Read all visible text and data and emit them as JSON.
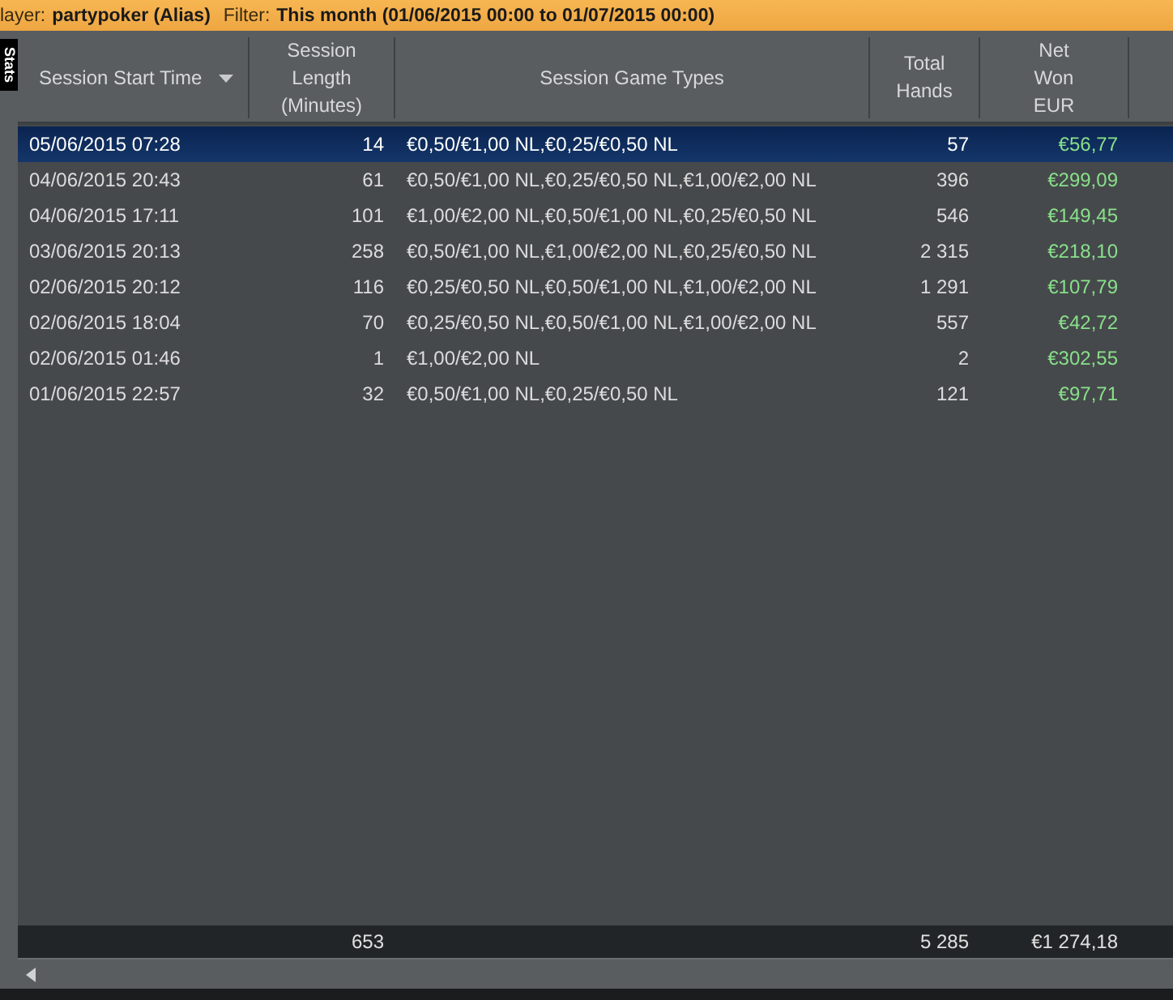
{
  "filter_bar": {
    "player_label": "layer:",
    "player": "partypoker (Alias)",
    "filter_label": "Filter:",
    "filter": "This month (01/06/2015 00:00 to 01/07/2015 00:00)"
  },
  "side_tab": {
    "label": "Stats"
  },
  "table": {
    "columns": [
      {
        "label": "Session Start Time",
        "sorted": true
      },
      {
        "label": "Session Length (Minutes)",
        "sorted": false
      },
      {
        "label": "Session Game Types",
        "sorted": false
      },
      {
        "label": "Total Hands",
        "sorted": false
      },
      {
        "label": "Net Won EUR",
        "sorted": false
      }
    ],
    "rows": [
      {
        "selected": true,
        "cells": [
          "05/06/2015 07:28",
          "14",
          "€0,50/€1,00 NL,€0,25/€0,50 NL",
          "57",
          "€56,77"
        ]
      },
      {
        "selected": false,
        "cells": [
          "04/06/2015 20:43",
          "61",
          "€0,50/€1,00 NL,€0,25/€0,50 NL,€1,00/€2,00 NL",
          "396",
          "€299,09"
        ]
      },
      {
        "selected": false,
        "cells": [
          "04/06/2015 17:11",
          "101",
          "€1,00/€2,00 NL,€0,50/€1,00 NL,€0,25/€0,50 NL",
          "546",
          "€149,45"
        ]
      },
      {
        "selected": false,
        "cells": [
          "03/06/2015 20:13",
          "258",
          "€0,50/€1,00 NL,€1,00/€2,00 NL,€0,25/€0,50 NL",
          "2 315",
          "€218,10"
        ]
      },
      {
        "selected": false,
        "cells": [
          "02/06/2015 20:12",
          "116",
          "€0,25/€0,50 NL,€0,50/€1,00 NL,€1,00/€2,00 NL",
          "1 291",
          "€107,79"
        ]
      },
      {
        "selected": false,
        "cells": [
          "02/06/2015 18:04",
          "70",
          "€0,25/€0,50 NL,€0,50/€1,00 NL,€1,00/€2,00 NL",
          "557",
          "€42,72"
        ]
      },
      {
        "selected": false,
        "cells": [
          "02/06/2015 01:46",
          "1",
          "€1,00/€2,00 NL",
          "2",
          "€302,55"
        ]
      },
      {
        "selected": false,
        "cells": [
          "01/06/2015 22:57",
          "32",
          "€0,50/€1,00 NL,€0,25/€0,50 NL",
          "121",
          "€97,71"
        ]
      }
    ],
    "totals": {
      "session_length": "653",
      "total_hands": "5 285",
      "net_won": "€1 274,18"
    }
  }
}
